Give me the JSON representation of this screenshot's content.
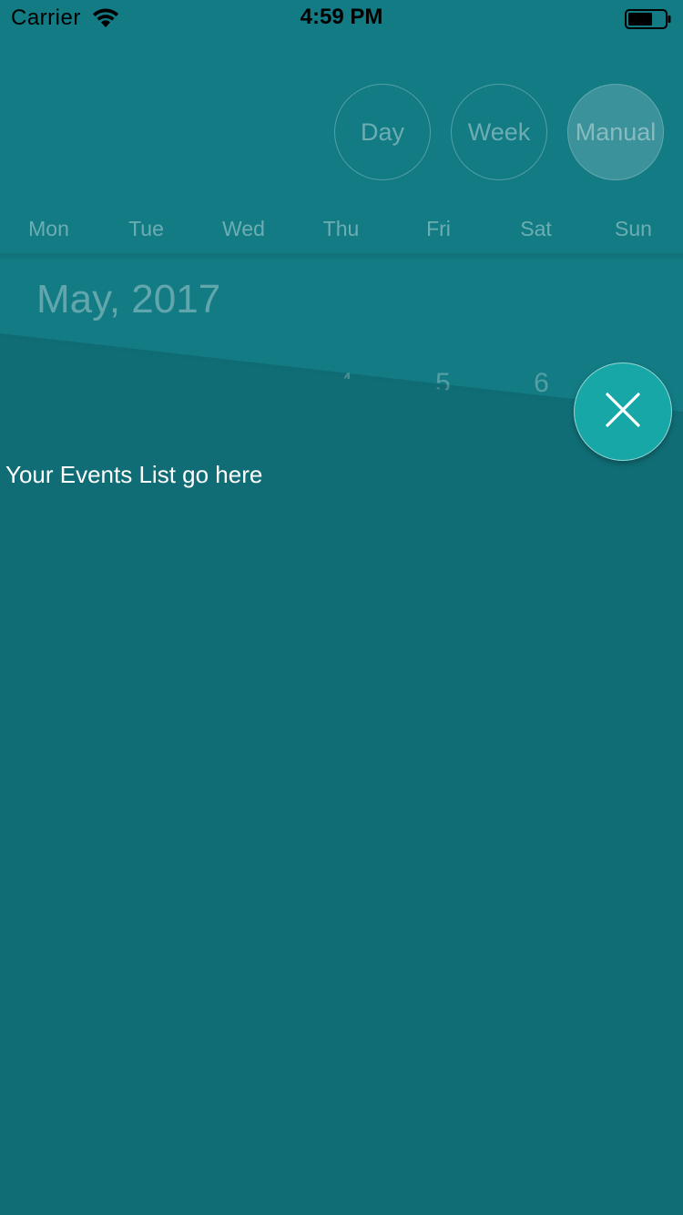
{
  "status_bar": {
    "carrier": "Carrier",
    "time": "4:59 PM",
    "wifi_icon": "wifi-icon",
    "battery_icon": "battery-icon"
  },
  "modes": {
    "day": "Day",
    "week": "Week",
    "manual": "Manual",
    "selected": "Manual"
  },
  "weekdays": [
    "Mon",
    "Tue",
    "Wed",
    "Thu",
    "Fri",
    "Sat",
    "Sun"
  ],
  "calendar": {
    "month": "May, 2017",
    "visible_dates": [
      "4",
      "5",
      "6"
    ]
  },
  "events": {
    "placeholder": "Your Events List go here"
  },
  "fab": {
    "icon": "close-icon"
  },
  "colors": {
    "background": "#127b84",
    "overlay": "#106d75",
    "fab": "#17a7a7"
  }
}
